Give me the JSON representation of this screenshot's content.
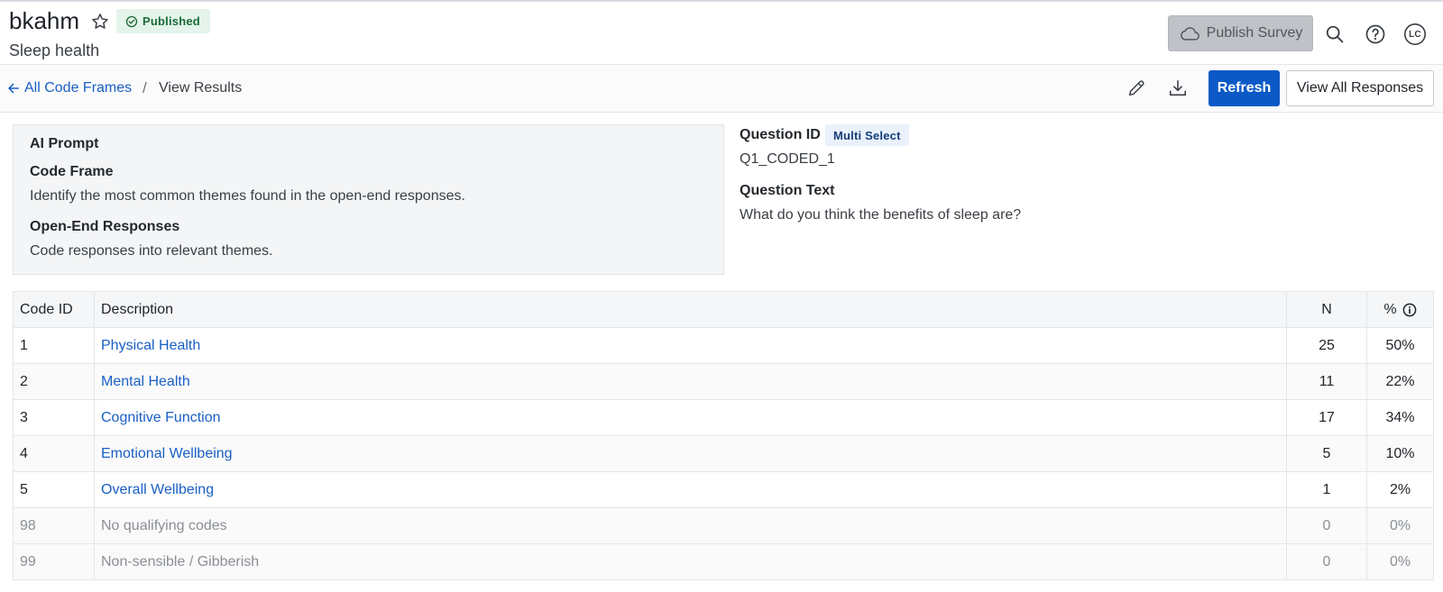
{
  "header": {
    "title": "bkahm",
    "subtitle": "Sleep health",
    "status_badge": "Published",
    "publish_label": "Publish Survey",
    "avatar_initials": "LC"
  },
  "toolbar": {
    "back_label": "All Code Frames",
    "separator": "/",
    "current": "View Results",
    "refresh_label": "Refresh",
    "view_all_label": "View All Responses"
  },
  "prompt": {
    "title": "AI Prompt",
    "code_frame_heading": "Code Frame",
    "code_frame_text": "Identify the most common themes found in the open-end responses.",
    "open_end_heading": "Open-End Responses",
    "open_end_text": "Code responses into relevant themes."
  },
  "question": {
    "id_label": "Question ID",
    "type_badge": "Multi Select",
    "id_value": "Q1_CODED_1",
    "text_label": "Question Text",
    "text_value": "What do you think the benefits of sleep are?"
  },
  "table": {
    "headers": {
      "code_id": "Code ID",
      "description": "Description",
      "n": "N",
      "pct": "%"
    },
    "rows": [
      {
        "code_id": "1",
        "description": "Physical Health",
        "n": "25",
        "pct": "50%"
      },
      {
        "code_id": "2",
        "description": "Mental Health",
        "n": "11",
        "pct": "22%"
      },
      {
        "code_id": "3",
        "description": "Cognitive Function",
        "n": "17",
        "pct": "34%"
      },
      {
        "code_id": "4",
        "description": "Emotional Wellbeing",
        "n": "5",
        "pct": "10%"
      },
      {
        "code_id": "5",
        "description": "Overall Wellbeing",
        "n": "1",
        "pct": "2%"
      },
      {
        "code_id": "98",
        "description": "No qualifying codes",
        "n": "0",
        "pct": "0%"
      },
      {
        "code_id": "99",
        "description": "Non-sensible / Gibberish",
        "n": "0",
        "pct": "0%"
      }
    ]
  },
  "colors": {
    "accent": "#0b59c7",
    "link": "#1a5fc4",
    "published_bg": "#e4f4ea",
    "published_text": "#1c6b3a",
    "muted_text": "#8a8f96"
  },
  "icons": [
    "star-icon",
    "check-circle-icon",
    "cloud-icon",
    "search-icon",
    "help-icon",
    "avatar",
    "arrow-left-icon",
    "pencil-icon",
    "download-icon",
    "info-icon"
  ]
}
